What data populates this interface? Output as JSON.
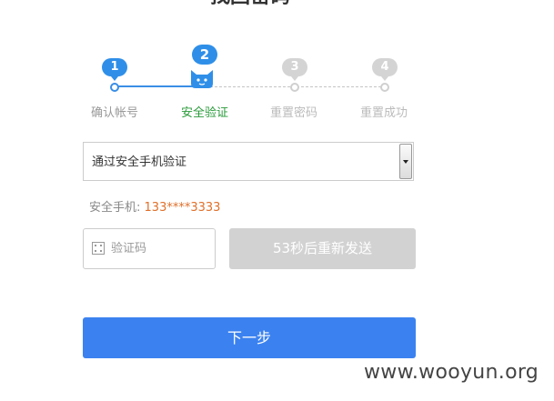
{
  "page_title": "找回密码",
  "steps": [
    {
      "number": "1",
      "label": "确认帐号",
      "state": "done"
    },
    {
      "number": "2",
      "label": "安全验证",
      "state": "active"
    },
    {
      "number": "3",
      "label": "重置密码",
      "state": "todo"
    },
    {
      "number": "4",
      "label": "重置成功",
      "state": "todo"
    }
  ],
  "verify": {
    "method_selected": "通过安全手机验证",
    "phone_label": "安全手机:",
    "phone_value": "133****3333",
    "code_placeholder": "验证码",
    "resend_label": "53秒后重新发送",
    "next_label": "下一步"
  },
  "watermark": "www.wooyun.org",
  "colors": {
    "accent": "#3b82f0",
    "step_done": "#2f8fe8",
    "step_active_label": "#2a9a3a",
    "phone_value": "#e0702a",
    "disabled_button": "#d2d2d2"
  },
  "icons": {
    "code_field": "grid-code-icon",
    "active_step": "cat-mascot-icon",
    "select_arrow": "chevron-down-icon"
  }
}
